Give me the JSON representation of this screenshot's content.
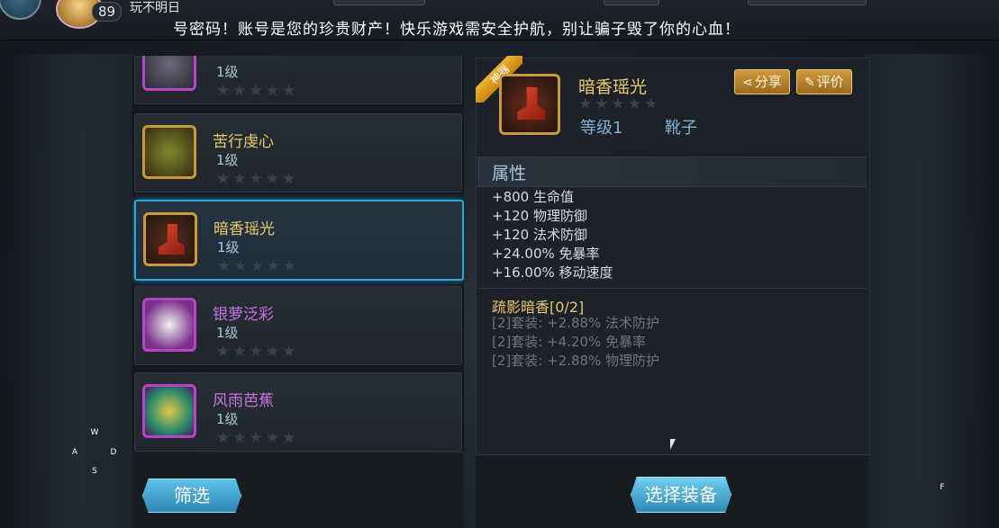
{
  "top": {
    "level": "89",
    "player_name": "玩不明日",
    "marquee": "号密码！账号是您的珍贵财产！快乐游戏需安全护航，别让骗子毁了你的心血！"
  },
  "equipment_list": [
    {
      "name": "",
      "level": "1级",
      "stars": "★★★★★",
      "frame": "purple-armor"
    },
    {
      "name": "苦行虔心",
      "level": "1级",
      "stars": "★★★★★",
      "frame": "gold"
    },
    {
      "name": "暗香瑶光",
      "level": "1级",
      "stars": "★★★★★",
      "frame": "gold",
      "selected": true
    },
    {
      "name": "银萝泛彩",
      "level": "1级",
      "stars": "★★★★★",
      "frame": "purple"
    },
    {
      "name": "风雨芭蕉",
      "level": "1级",
      "stars": "★★★★★",
      "frame": "purple"
    }
  ],
  "buttons": {
    "filter": "筛选",
    "equip": "选择装备",
    "share": "分享",
    "rate": "评价"
  },
  "detail": {
    "ribbon": "神器",
    "name": "暗香瑶光",
    "stars": "★★★★★",
    "level": "等级1",
    "type": "靴子",
    "attr_title": "属性",
    "stats": [
      "+800 生命值",
      "+120 物理防御",
      "+120 法术防御",
      "+24.00% 免暴率",
      "+16.00% 移动速度"
    ],
    "set_name": "疏影暗香[0/2]",
    "set_bonuses": [
      "[2]套装: +2.88% 法术防护",
      "[2]套装: +4.20% 免暴率",
      "[2]套装: +2.88% 物理防护"
    ]
  },
  "keys": {
    "w": "W",
    "a": "A",
    "s": "S",
    "d": "D",
    "f": "F"
  }
}
